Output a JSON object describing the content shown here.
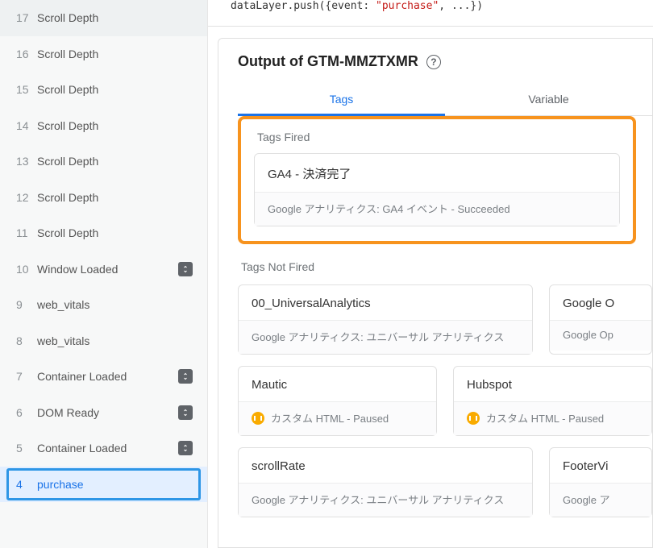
{
  "code_line": {
    "pre": "dataLayer.push({event: ",
    "str": "\"purchase\"",
    "post": ", ...})"
  },
  "output_title": "Output of GTM-MMZTXMR",
  "tabs": {
    "tags": "Tags",
    "variables": "Variable"
  },
  "labels": {
    "fired": "Tags Fired",
    "not_fired": "Tags Not Fired"
  },
  "fired_tag": {
    "name": "GA4 - 決済完了",
    "meta": "Google アナリティクス: GA4 イベント - Succeeded"
  },
  "not_fired": {
    "row1": [
      {
        "name": "00_UniversalAnalytics",
        "meta": "Google アナリティクス: ユニバーサル アナリティクス",
        "paused": false
      },
      {
        "name": "Google O",
        "meta": "Google Op",
        "paused": false
      }
    ],
    "row2": [
      {
        "name": "Mautic",
        "meta": "カスタム HTML - Paused",
        "paused": true
      },
      {
        "name": "Hubspot",
        "meta": "カスタム HTML - Paused",
        "paused": true
      }
    ],
    "row3": [
      {
        "name": "scrollRate",
        "meta": "Google アナリティクス: ユニバーサル アナリティクス",
        "paused": false
      },
      {
        "name": "FooterVi",
        "meta": "Google ア",
        "paused": false
      }
    ]
  },
  "events": [
    {
      "seq": "17",
      "name": "Scroll Depth",
      "icon": false,
      "selected": false
    },
    {
      "seq": "16",
      "name": "Scroll Depth",
      "icon": false,
      "selected": false
    },
    {
      "seq": "15",
      "name": "Scroll Depth",
      "icon": false,
      "selected": false
    },
    {
      "seq": "14",
      "name": "Scroll Depth",
      "icon": false,
      "selected": false
    },
    {
      "seq": "13",
      "name": "Scroll Depth",
      "icon": false,
      "selected": false
    },
    {
      "seq": "12",
      "name": "Scroll Depth",
      "icon": false,
      "selected": false
    },
    {
      "seq": "11",
      "name": "Scroll Depth",
      "icon": false,
      "selected": false
    },
    {
      "seq": "10",
      "name": "Window Loaded",
      "icon": true,
      "selected": false
    },
    {
      "seq": "9",
      "name": "web_vitals",
      "icon": false,
      "selected": false
    },
    {
      "seq": "8",
      "name": "web_vitals",
      "icon": false,
      "selected": false
    },
    {
      "seq": "7",
      "name": "Container Loaded",
      "icon": true,
      "selected": false
    },
    {
      "seq": "6",
      "name": "DOM Ready",
      "icon": true,
      "selected": false
    },
    {
      "seq": "5",
      "name": "Container Loaded",
      "icon": true,
      "selected": false
    },
    {
      "seq": "4",
      "name": "purchase",
      "icon": false,
      "selected": true
    }
  ]
}
